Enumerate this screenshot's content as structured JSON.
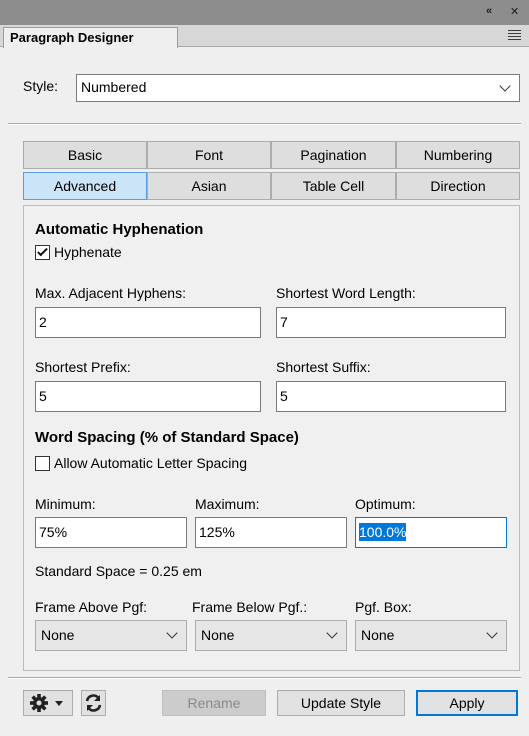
{
  "window": {
    "collapse_glyph": "«",
    "close_glyph": "✕"
  },
  "panel": {
    "tab_title": "Paragraph Designer",
    "menu_icon": "hamburger-icon"
  },
  "style": {
    "label": "Style:",
    "value": "Numbered"
  },
  "tabs": {
    "row1": [
      "Basic",
      "Font",
      "Pagination",
      "Numbering"
    ],
    "row2": [
      "Advanced",
      "Asian",
      "Table Cell",
      "Direction"
    ],
    "active": "Advanced"
  },
  "hyphenation": {
    "title": "Automatic Hyphenation",
    "hyphenate_label": "Hyphenate",
    "hyphenate_checked": true,
    "max_adjacent_label": "Max. Adjacent Hyphens:",
    "max_adjacent_value": "2",
    "shortest_word_label": "Shortest Word Length:",
    "shortest_word_value": "7",
    "shortest_prefix_label": "Shortest Prefix:",
    "shortest_prefix_value": "5",
    "shortest_suffix_label": "Shortest Suffix:",
    "shortest_suffix_value": "5"
  },
  "word_spacing": {
    "title": "Word Spacing (% of Standard Space)",
    "allow_letter_spacing_label": "Allow Automatic Letter Spacing",
    "allow_letter_spacing_checked": false,
    "minimum_label": "Minimum:",
    "minimum_value": "75%",
    "maximum_label": "Maximum:",
    "maximum_value": "125%",
    "optimum_label": "Optimum:",
    "optimum_value": "100.0%",
    "standard_space_text": "Standard Space = 0.25 em"
  },
  "frames": {
    "above_label": "Frame Above Pgf:",
    "above_value": "None",
    "below_label": "Frame Below Pgf.:",
    "below_value": "None",
    "box_label": "Pgf. Box:",
    "box_value": "None"
  },
  "buttons": {
    "settings_icon": "gear-icon",
    "refresh_icon": "refresh-icon",
    "rename": "Rename",
    "update_style": "Update Style",
    "apply": "Apply"
  },
  "colors": {
    "accent": "#0078d7",
    "active_tab": "#cce4f7"
  }
}
